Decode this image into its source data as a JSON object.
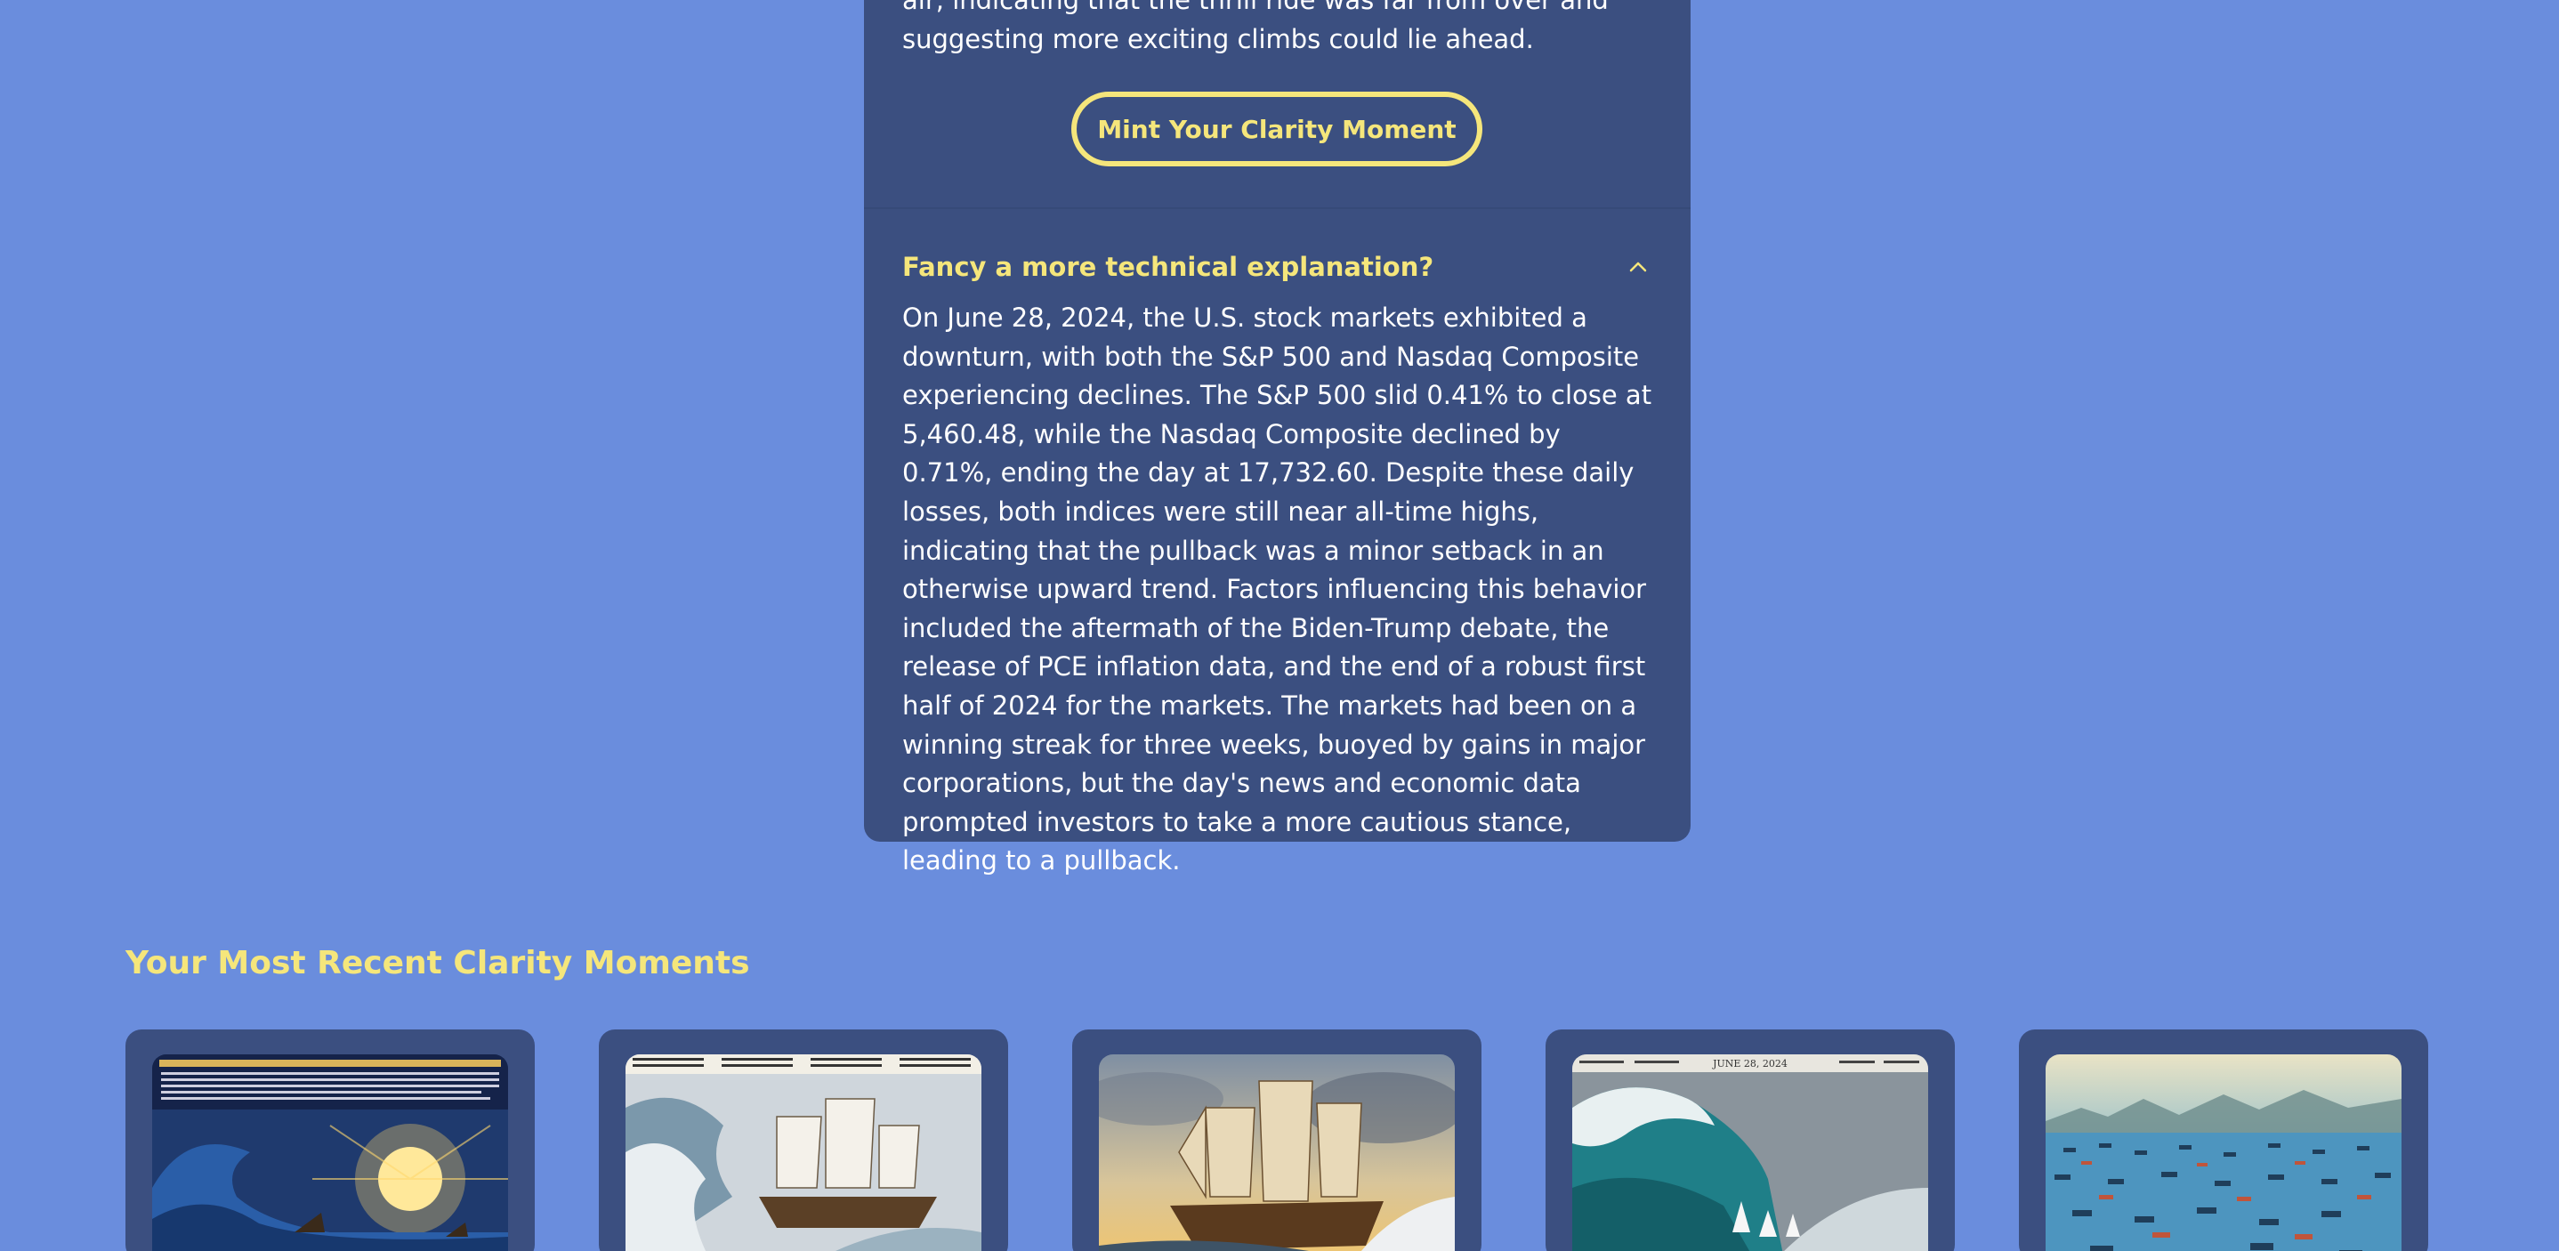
{
  "story": {
    "tail_text": "air, indicating that the thrill ride was far from over and suggesting more exciting climbs could lie ahead."
  },
  "mint_button": {
    "label": "Mint Your Clarity Moment"
  },
  "technical": {
    "title": "Fancy a more technical explanation?",
    "expanded": true,
    "icon": "chevron-up-icon",
    "body": "On June 28, 2024, the U.S. stock markets exhibited a downturn, with both the S&P 500 and Nasdaq Composite experiencing declines. The S&P 500 slid 0.41% to close at 5,460.48, while the Nasdaq Composite declined by 0.71%, ending the day at 17,732.60. Despite these daily losses, both indices were still near all-time highs, indicating that the pullback was a minor setback in an otherwise upward trend. Factors influencing this behavior included the aftermath of the Biden-Trump debate, the release of PCE inflation data, and the end of a robust first half of 2024 for the markets. The markets had been on a winning streak for three weeks, buoyed by gains in major corporations, but the day's news and economic data prompted investors to take a more cautious stance, leading to a pullback."
  },
  "recent": {
    "title": "Your Most Recent Clarity Moments",
    "cards": [
      {
        "image": "newspaper-wave-sunrise-image",
        "caption": ""
      },
      {
        "image": "newspaper-sailing-ship-storm-image",
        "caption": ""
      },
      {
        "image": "sailing-ship-sunset-image",
        "caption": ""
      },
      {
        "image": "newspaper-giant-wave-image",
        "caption": "JUNE 28, 2024"
      },
      {
        "image": "sea-of-boats-image",
        "caption": ""
      }
    ]
  },
  "colors": {
    "background": "#6a8ddd",
    "card": "#3b4f80",
    "accent": "#f5e67b",
    "text": "#ffffff"
  }
}
